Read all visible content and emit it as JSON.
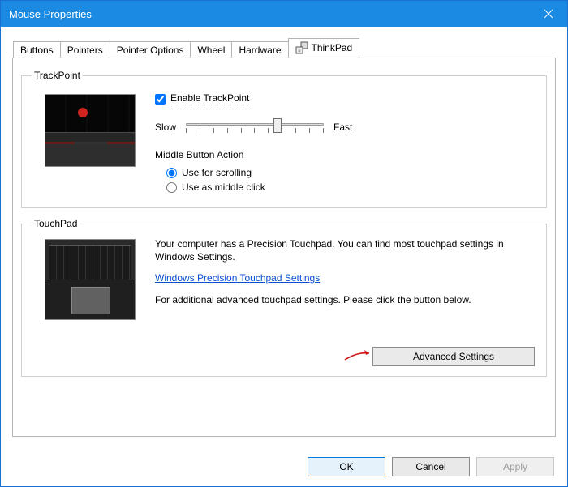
{
  "window": {
    "title": "Mouse Properties"
  },
  "tabs": {
    "buttons": "Buttons",
    "pointers": "Pointers",
    "pointer_options": "Pointer Options",
    "wheel": "Wheel",
    "hardware": "Hardware",
    "thinkpad": "ThinkPad"
  },
  "trackpoint": {
    "legend": "TrackPoint",
    "enable_label": "Enable TrackPoint",
    "slow": "Slow",
    "fast": "Fast",
    "mid_label": "Middle Button Action",
    "radio_scroll": "Use for scrolling",
    "radio_middle": "Use as middle click"
  },
  "touchpad": {
    "legend": "TouchPad",
    "line1": "Your computer has a Precision Touchpad. You can find most touchpad settings in Windows Settings.",
    "link": "Windows Precision Touchpad Settings",
    "line2": "For additional advanced touchpad settings. Please click the button below.",
    "advanced_btn": "Advanced Settings"
  },
  "buttons_row": {
    "ok": "OK",
    "cancel": "Cancel",
    "apply": "Apply"
  }
}
